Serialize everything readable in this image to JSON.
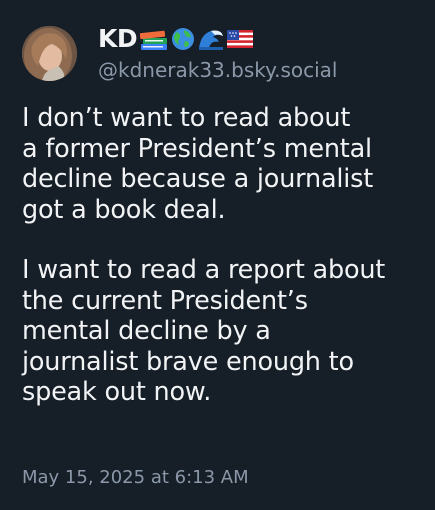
{
  "author": {
    "display_name": "KD",
    "emoji": [
      "books-emoji",
      "globe-emoji",
      "wave-emoji",
      "us-flag-emoji"
    ],
    "handle": "@kdnerak33.bsky.social"
  },
  "post": {
    "paragraphs": [
      "I don’t want to read about\na former President’s mental\ndecline because a journalist\ngot a book deal.",
      "I want to read a report about\nthe current President’s\nmental decline by a\njournalist brave enough to\nspeak out now."
    ],
    "timestamp": "May 15, 2025 at 6:13 AM"
  },
  "colors": {
    "background": "#161e27",
    "text": "#f1f3f5",
    "muted": "#8b98a9"
  }
}
